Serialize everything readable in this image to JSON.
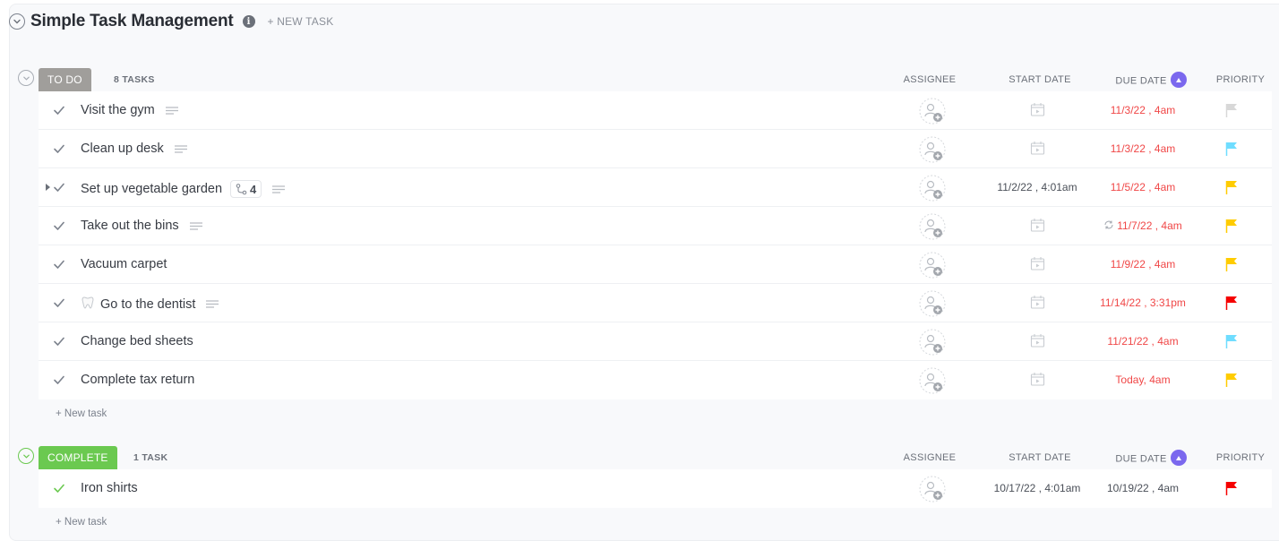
{
  "list": {
    "title": "Simple Task Management",
    "new_task_label": "+ NEW TASK"
  },
  "columns": {
    "assignee": "ASSIGNEE",
    "start_date": "START DATE",
    "due_date": "DUE DATE",
    "priority": "PRIORITY"
  },
  "colors": {
    "accent": "#7b68ee",
    "todo": "#a09e9b",
    "complete": "#6bc950",
    "overdue": "#f04747",
    "priority_urgent": "#f50000",
    "priority_high": "#ffcc00",
    "priority_normal": "#6fddff",
    "priority_low": "#d8d8d8"
  },
  "groups": [
    {
      "status": "TO DO",
      "count_label": "8 TASKS",
      "new_task_label": "+ New task",
      "tasks": [
        {
          "name": "Visit the gym",
          "has_description": true,
          "start": "",
          "due": "11/3/22 , 4am",
          "overdue": true,
          "recurring": false,
          "priority": "low"
        },
        {
          "name": "Clean up desk",
          "has_description": true,
          "start": "",
          "due": "11/3/22 , 4am",
          "overdue": true,
          "recurring": false,
          "priority": "normal"
        },
        {
          "name": "Set up vegetable garden",
          "has_description": true,
          "subtasks": "4",
          "start": "11/2/22 , 4:01am",
          "due": "11/5/22 , 4am",
          "overdue": true,
          "recurring": false,
          "priority": "high"
        },
        {
          "name": "Take out the bins",
          "has_description": true,
          "start": "",
          "due": "11/7/22 , 4am",
          "overdue": true,
          "recurring": true,
          "priority": "high"
        },
        {
          "name": "Vacuum carpet",
          "has_description": false,
          "start": "",
          "due": "11/9/22 , 4am",
          "overdue": true,
          "recurring": false,
          "priority": "high"
        },
        {
          "name": "Go to the dentist",
          "emoji": "tooth",
          "has_description": true,
          "start": "",
          "due": "11/14/22 , 3:31pm",
          "overdue": true,
          "recurring": false,
          "priority": "urgent"
        },
        {
          "name": "Change bed sheets",
          "has_description": false,
          "start": "",
          "due": "11/21/22 , 4am",
          "overdue": true,
          "recurring": false,
          "priority": "normal"
        },
        {
          "name": "Complete tax return",
          "has_description": false,
          "start": "",
          "due": "Today, 4am",
          "overdue": true,
          "recurring": false,
          "priority": "high"
        }
      ]
    },
    {
      "status": "COMPLETE",
      "count_label": "1 TASK",
      "new_task_label": "+ New task",
      "tasks": [
        {
          "name": "Iron shirts",
          "has_description": false,
          "start": "10/17/22 , 4:01am",
          "due": "10/19/22 , 4am",
          "overdue": false,
          "recurring": false,
          "priority": "urgent"
        }
      ]
    }
  ]
}
